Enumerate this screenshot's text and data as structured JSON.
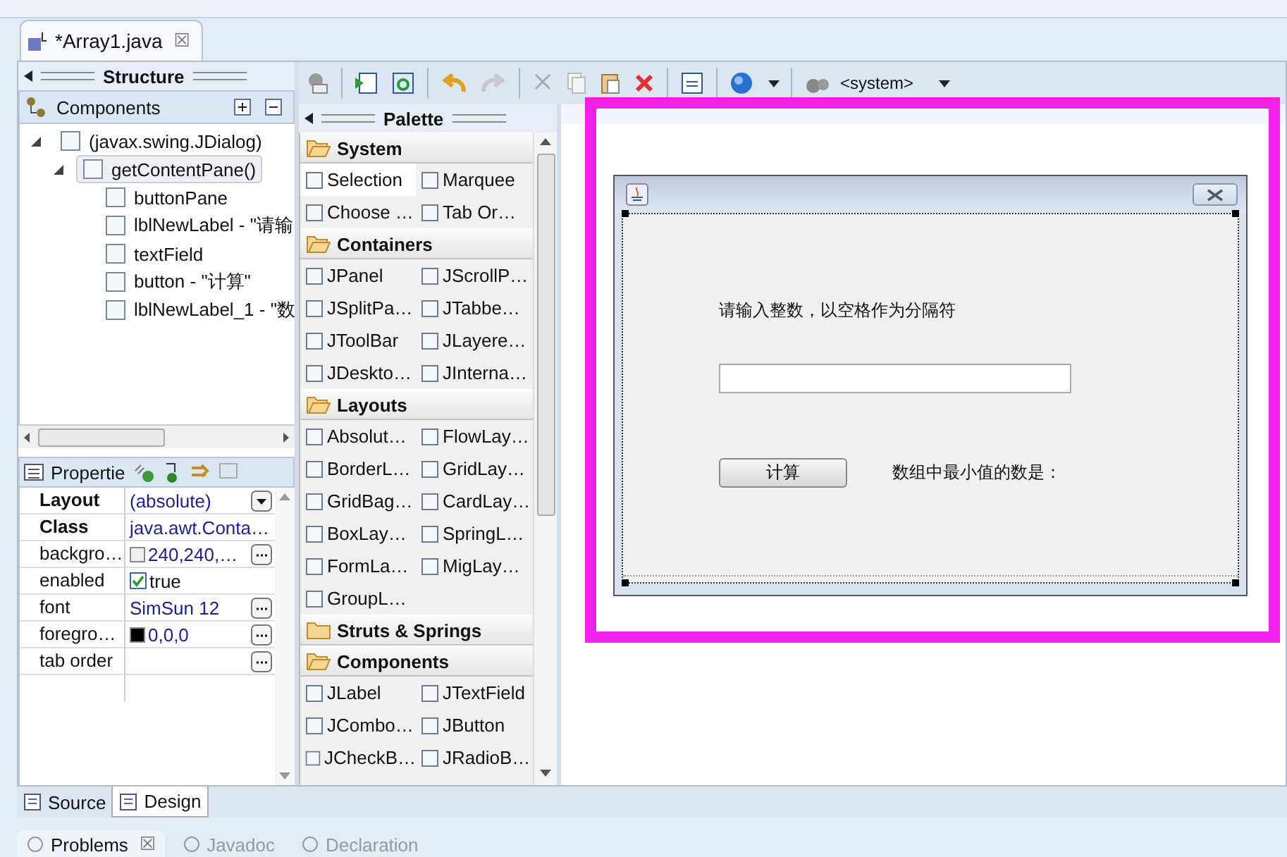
{
  "editor_tab": {
    "title": "*Array1.java",
    "close": "☒"
  },
  "structure": {
    "title": "Structure",
    "components_title": "Components",
    "tree": [
      {
        "label": "(javax.swing.JDialog)",
        "expanded": true,
        "selected": false,
        "children": [
          {
            "label": "getContentPane()",
            "expanded": true,
            "selected": true,
            "children": [
              {
                "label": "buttonPane",
                "selected": false
              },
              {
                "label": "lblNewLabel - \"请输",
                "selected": false
              },
              {
                "label": "textField",
                "selected": false
              },
              {
                "label": "button - \"计算\"",
                "selected": false
              },
              {
                "label": "lblNewLabel_1 - \"数",
                "selected": false
              }
            ]
          }
        ]
      }
    ]
  },
  "properties": {
    "title": "Propertie",
    "rows": [
      {
        "name": "Layout",
        "value": "(absolute)",
        "bold": true,
        "kind": "dropdown"
      },
      {
        "name": "Class",
        "value": "java.awt.Conta…",
        "bold": true,
        "kind": "text"
      },
      {
        "name": "backgro…",
        "value": "240,240,…",
        "bold": false,
        "kind": "color",
        "color": "#f0f0f0"
      },
      {
        "name": "enabled",
        "value": "true",
        "bold": false,
        "kind": "check",
        "checked": true
      },
      {
        "name": "font",
        "value": "SimSun 12",
        "bold": false,
        "kind": "editor"
      },
      {
        "name": "foregro…",
        "value": "0,0,0",
        "bold": false,
        "kind": "color",
        "color": "#000000"
      },
      {
        "name": "tab order",
        "value": "",
        "bold": false,
        "kind": "editor"
      }
    ]
  },
  "toolbar": {
    "system_dropdown": "<system>"
  },
  "palette": {
    "title": "Palette",
    "groups": [
      {
        "label": "System",
        "expanded": true,
        "items": [
          {
            "label": "Selection",
            "selected": true
          },
          {
            "label": "Marquee",
            "selected": false
          },
          {
            "label": "Choose …",
            "selected": false
          },
          {
            "label": "Tab Or…",
            "selected": false
          }
        ]
      },
      {
        "label": "Containers",
        "expanded": true,
        "items": [
          {
            "label": "JPanel",
            "selected": false
          },
          {
            "label": "JScrollP…",
            "selected": false
          },
          {
            "label": "JSplitPa…",
            "selected": false
          },
          {
            "label": "JTabbe…",
            "selected": false
          },
          {
            "label": "JToolBar",
            "selected": false
          },
          {
            "label": "JLayere…",
            "selected": false
          },
          {
            "label": "JDeskto…",
            "selected": false
          },
          {
            "label": "JInterna…",
            "selected": false
          }
        ]
      },
      {
        "label": "Layouts",
        "expanded": true,
        "items": [
          {
            "label": "Absolut…",
            "selected": false
          },
          {
            "label": "FlowLay…",
            "selected": false
          },
          {
            "label": "BorderL…",
            "selected": false
          },
          {
            "label": "GridLay…",
            "selected": false
          },
          {
            "label": "GridBag…",
            "selected": false
          },
          {
            "label": "CardLay…",
            "selected": false
          },
          {
            "label": "BoxLay…",
            "selected": false
          },
          {
            "label": "SpringL…",
            "selected": false
          },
          {
            "label": "FormLa…",
            "selected": false
          },
          {
            "label": "MigLay…",
            "selected": false
          },
          {
            "label": "GroupL…",
            "selected": false
          }
        ]
      },
      {
        "label": "Struts & Springs",
        "expanded": false
      },
      {
        "label": "Components",
        "expanded": true,
        "items": [
          {
            "label": "JLabel",
            "selected": false
          },
          {
            "label": "JTextField",
            "selected": false
          },
          {
            "label": "JCombo…",
            "selected": false
          },
          {
            "label": "JButton",
            "selected": false
          },
          {
            "label": "JCheckB…",
            "selected": false
          },
          {
            "label": "JRadioB…",
            "selected": false
          }
        ]
      }
    ]
  },
  "dialog": {
    "prompt": "请输入整数，以空格作为分隔符",
    "button": "计算",
    "result_label": "数组中最小值的数是："
  },
  "bottom_tabs": [
    {
      "label": "Source",
      "selected": false
    },
    {
      "label": "Design",
      "selected": true
    }
  ],
  "views": [
    {
      "label": "Problems",
      "selected": true,
      "close": "☒"
    },
    {
      "label": "Javadoc",
      "selected": false
    },
    {
      "label": "Declaration",
      "selected": false
    }
  ]
}
